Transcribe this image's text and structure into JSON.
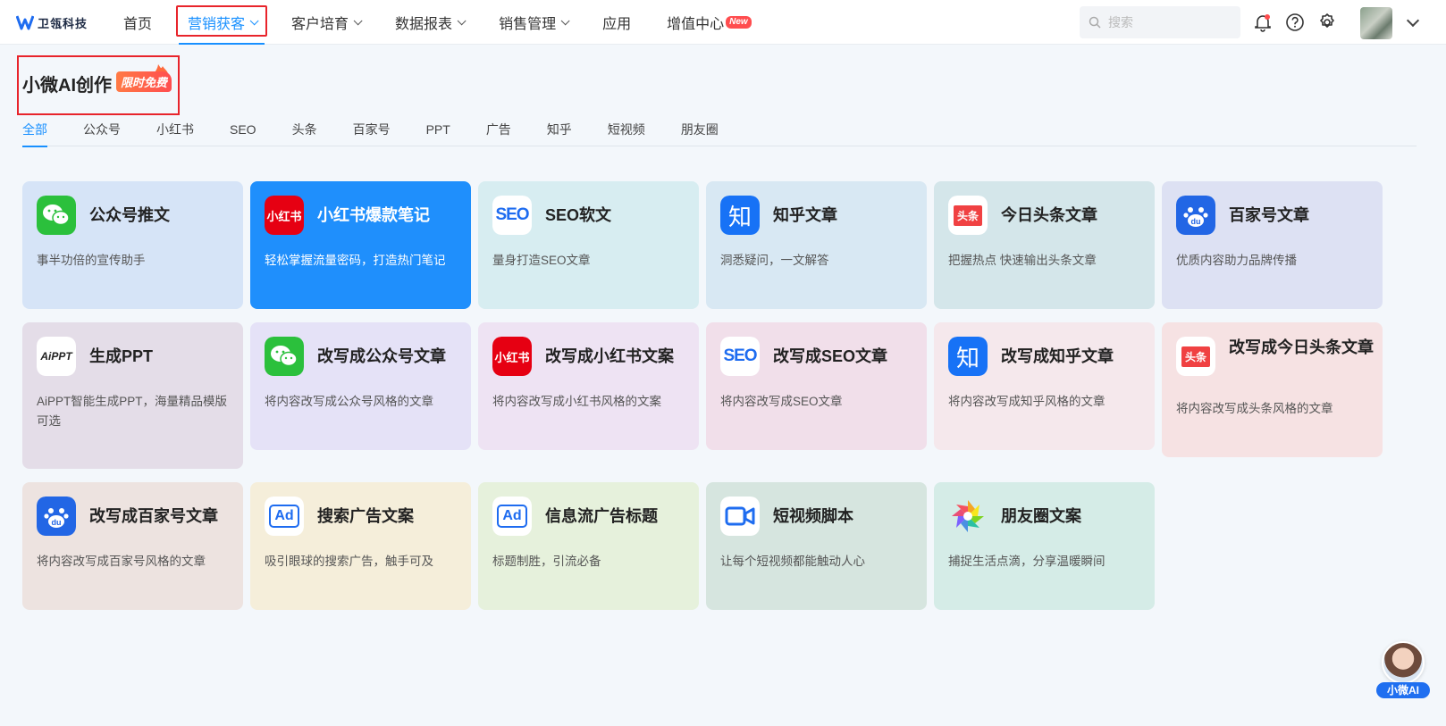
{
  "header": {
    "logo_text": "卫瓴科技",
    "nav": [
      {
        "label": "首页",
        "has_dropdown": false,
        "active": false
      },
      {
        "label": "营销获客",
        "has_dropdown": true,
        "active": true
      },
      {
        "label": "客户培育",
        "has_dropdown": true,
        "active": false
      },
      {
        "label": "数据报表",
        "has_dropdown": true,
        "active": false
      },
      {
        "label": "销售管理",
        "has_dropdown": true,
        "active": false
      },
      {
        "label": "应用",
        "has_dropdown": false,
        "active": false
      },
      {
        "label": "增值中心",
        "has_dropdown": false,
        "active": false,
        "badge": "New"
      }
    ],
    "search_placeholder": "搜索",
    "icons": [
      "bell-icon",
      "help-icon",
      "gear-icon"
    ],
    "accent": "#1890ff"
  },
  "page": {
    "title": "小微AI创作",
    "tag": "限时免费"
  },
  "tabs": [
    "全部",
    "公众号",
    "小红书",
    "SEO",
    "头条",
    "百家号",
    "PPT",
    "广告",
    "知乎",
    "短视频",
    "朋友圈"
  ],
  "active_tab": "全部",
  "cards": [
    {
      "title": "公众号推文",
      "desc": "事半功倍的宣传助手",
      "icon": "wechat-icon",
      "bg": "#d6e4f7"
    },
    {
      "title": "小红书爆款笔记",
      "desc": "轻松掌握流量密码，打造热门笔记",
      "icon": "xiaohongshu-icon",
      "bg": "#1f8ffc",
      "highlight": true
    },
    {
      "title": "SEO软文",
      "desc": "量身打造SEO文章",
      "icon": "seo-icon",
      "bg": "#d7edf1"
    },
    {
      "title": "知乎文章",
      "desc": "洞悉疑问，一文解答",
      "icon": "zhihu-icon",
      "bg": "#d8e8f3"
    },
    {
      "title": "今日头条文章",
      "desc": "把握热点 快速输出头条文章",
      "icon": "toutiao-icon",
      "bg": "#d4e6ea"
    },
    {
      "title": "百家号文章",
      "desc": "优质内容助力品牌传播",
      "icon": "baidu-icon",
      "bg": "#dde1f3"
    },
    {
      "title": "生成PPT",
      "desc": "AiPPT智能生成PPT，海量精品模版可选",
      "icon": "aippt-icon",
      "bg": "#e4dde8"
    },
    {
      "title": "改写成公众号文章",
      "desc": "将内容改写成公众号风格的文章",
      "icon": "wechat-icon",
      "bg": "#e5e2f7"
    },
    {
      "title": "改写成小红书文案",
      "desc": "将内容改写成小红书风格的文案",
      "icon": "xiaohongshu-icon",
      "bg": "#eee3f3"
    },
    {
      "title": "改写成SEO文章",
      "desc": "将内容改写成SEO文章",
      "icon": "seo-icon",
      "bg": "#f1dfea"
    },
    {
      "title": "改写成知乎文章",
      "desc": "将内容改写成知乎风格的文章",
      "icon": "zhihu-icon",
      "bg": "#f5e8ec"
    },
    {
      "title": "改写成今日头条文章",
      "desc": "将内容改写成头条风格的文章",
      "icon": "toutiao-icon",
      "bg": "#f6e2e3"
    },
    {
      "title": "改写成百家号文章",
      "desc": "将内容改写成百家号风格的文章",
      "icon": "baidu-icon",
      "bg": "#ede3e0"
    },
    {
      "title": "搜索广告文案",
      "desc": "吸引眼球的搜索广告，触手可及",
      "icon": "ad-icon",
      "bg": "#f5eeda"
    },
    {
      "title": "信息流广告标题",
      "desc": "标题制胜，引流必备",
      "icon": "ad-icon",
      "bg": "#e6f1dc"
    },
    {
      "title": "短视频脚本",
      "desc": "让每个短视频都能触动人心",
      "icon": "video-icon",
      "bg": "#d6e5df"
    },
    {
      "title": "朋友圈文案",
      "desc": "捕捉生活点滴，分享温暖瞬间",
      "icon": "moments-icon",
      "bg": "#d5ece7"
    }
  ],
  "assistant": {
    "label": "小微AI"
  }
}
